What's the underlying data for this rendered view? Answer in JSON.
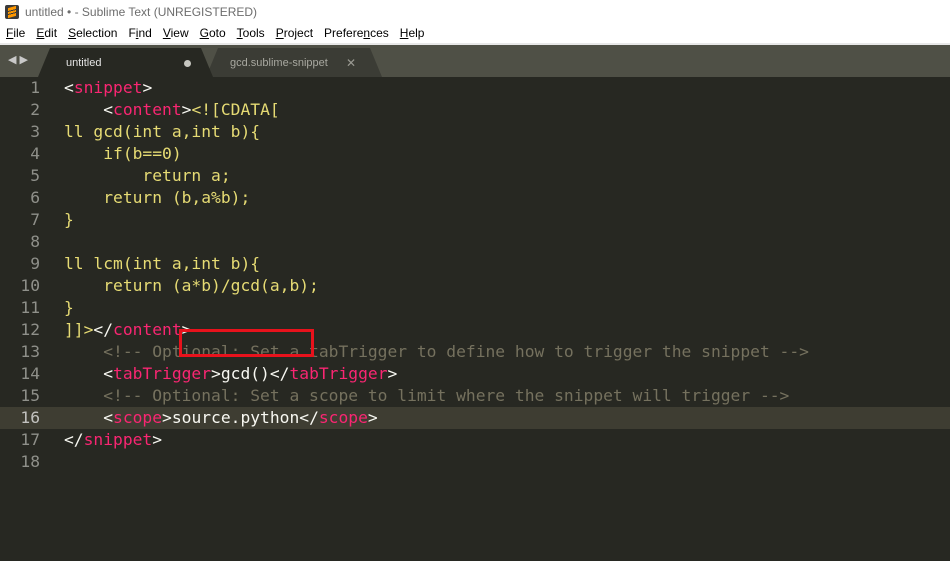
{
  "window": {
    "title": "untitled • - Sublime Text (UNREGISTERED)"
  },
  "menu": [
    {
      "pre": "",
      "u": "F",
      "post": "ile"
    },
    {
      "pre": "",
      "u": "E",
      "post": "dit"
    },
    {
      "pre": "",
      "u": "S",
      "post": "election"
    },
    {
      "pre": "F",
      "u": "i",
      "post": "nd"
    },
    {
      "pre": "",
      "u": "V",
      "post": "iew"
    },
    {
      "pre": "",
      "u": "G",
      "post": "oto"
    },
    {
      "pre": "",
      "u": "T",
      "post": "ools"
    },
    {
      "pre": "",
      "u": "P",
      "post": "roject"
    },
    {
      "pre": "Prefere",
      "u": "n",
      "post": "ces"
    },
    {
      "pre": "",
      "u": "H",
      "post": "elp"
    }
  ],
  "tabs": [
    {
      "label": "untitled",
      "active": true,
      "dirty": true
    },
    {
      "label": "gcd.sublime-snippet",
      "active": false,
      "dirty": false
    }
  ],
  "nav_icons": [
    "arrow-left-icon",
    "arrow-right-icon"
  ],
  "colors": {
    "background": "#272822",
    "tag": "#f92672",
    "string": "#e6db74",
    "comment": "#75715e",
    "text": "#f8f8f2",
    "highlight_box": "#e8121c"
  },
  "editor": {
    "current_line": 16,
    "lines": [
      {
        "n": "1",
        "tokens": [
          [
            "pun",
            "<"
          ],
          [
            "tag",
            "snippet"
          ],
          [
            "pun",
            ">"
          ]
        ]
      },
      {
        "n": "2",
        "tokens": [
          [
            "pun",
            "    <"
          ],
          [
            "tag",
            "content"
          ],
          [
            "pun",
            ">"
          ],
          [
            "str",
            "<![CDATA["
          ]
        ]
      },
      {
        "n": "3",
        "tokens": [
          [
            "str",
            "ll gcd(int a,int b){"
          ]
        ]
      },
      {
        "n": "4",
        "tokens": [
          [
            "str",
            "    if(b==0)"
          ]
        ]
      },
      {
        "n": "5",
        "tokens": [
          [
            "str",
            "        return a;"
          ]
        ]
      },
      {
        "n": "6",
        "tokens": [
          [
            "str",
            "    return (b,a%b);"
          ]
        ]
      },
      {
        "n": "7",
        "tokens": [
          [
            "str",
            "}"
          ]
        ]
      },
      {
        "n": "8",
        "tokens": []
      },
      {
        "n": "9",
        "tokens": [
          [
            "str",
            "ll lcm(int a,int b){"
          ]
        ]
      },
      {
        "n": "10",
        "tokens": [
          [
            "str",
            "    return (a*b)/gcd(a,b);"
          ]
        ]
      },
      {
        "n": "11",
        "tokens": [
          [
            "str",
            "}"
          ]
        ]
      },
      {
        "n": "12",
        "tokens": [
          [
            "str",
            "]]>"
          ],
          [
            "pun",
            "</"
          ],
          [
            "tag",
            "content"
          ],
          [
            "pun",
            ">"
          ]
        ]
      },
      {
        "n": "13",
        "tokens": [
          [
            "cmt",
            "    <!-- Optional: Set a tabTrigger to define how to trigger the snippet -->"
          ]
        ]
      },
      {
        "n": "14",
        "tokens": [
          [
            "pun",
            "    <"
          ],
          [
            "tag",
            "tabTrigger"
          ],
          [
            "pun",
            ">gcd()</"
          ],
          [
            "tag",
            "tabTrigger"
          ],
          [
            "pun",
            ">"
          ]
        ]
      },
      {
        "n": "15",
        "tokens": [
          [
            "cmt",
            "    <!-- Optional: Set a scope to limit where the snippet will trigger -->"
          ]
        ]
      },
      {
        "n": "16",
        "tokens": [
          [
            "pun",
            "    <"
          ],
          [
            "tag",
            "scope"
          ],
          [
            "pun",
            ">source.python</"
          ],
          [
            "tag",
            "scope"
          ],
          [
            "pun",
            ">"
          ]
        ]
      },
      {
        "n": "17",
        "tokens": [
          [
            "pun",
            "</"
          ],
          [
            "tag",
            "snippet"
          ],
          [
            "pun",
            ">"
          ]
        ]
      },
      {
        "n": "18",
        "tokens": []
      }
    ]
  }
}
